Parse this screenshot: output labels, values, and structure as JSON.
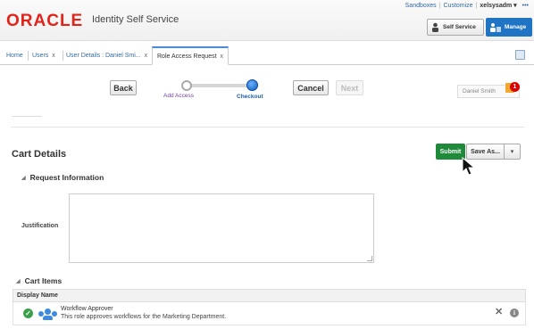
{
  "header": {
    "logo": "ORACLE",
    "app_title": "Identity Self Service",
    "links": [
      "Sandboxes",
      "Customize"
    ],
    "user": "xelsysadm",
    "user_caret": "▾",
    "more": "•••",
    "self_service_label": "Self Service",
    "manage_label": "Manage"
  },
  "tabs": [
    {
      "label": "Home"
    },
    {
      "label": "Users",
      "close": "x"
    },
    {
      "label": "User Details : Daniel Smi...",
      "close": "x"
    },
    {
      "label": "Role Access Request",
      "close": "x"
    }
  ],
  "train": {
    "back_label": "Back",
    "cancel_label": "Cancel",
    "next_label": "Next",
    "steps": [
      "Add Access",
      "Checkout"
    ],
    "owner_name": "Daniel Smith",
    "owner_badge": "1"
  },
  "cart": {
    "title": "Cart Details",
    "submit_label": "Submit",
    "save_as_label": "Save As...",
    "save_as_caret": "▾"
  },
  "request_info": {
    "title": "Request Information",
    "justification_label": "Justification",
    "justification_value": ""
  },
  "cart_items": {
    "title": "Cart Items",
    "column_header": "Display Name",
    "rows": [
      {
        "name": "Workflow Approver",
        "description": "This role approves workflows for the Marketing Department.",
        "status_icon": "check-icon",
        "type_icon": "role-icon"
      }
    ],
    "remove_glyph": "✕",
    "info_glyph": "i"
  },
  "colors": {
    "oracle_red": "#e2231a",
    "manage_blue": "#1f74c4",
    "submit_green": "#1e8a3a",
    "link_blue": "#356ba0"
  }
}
